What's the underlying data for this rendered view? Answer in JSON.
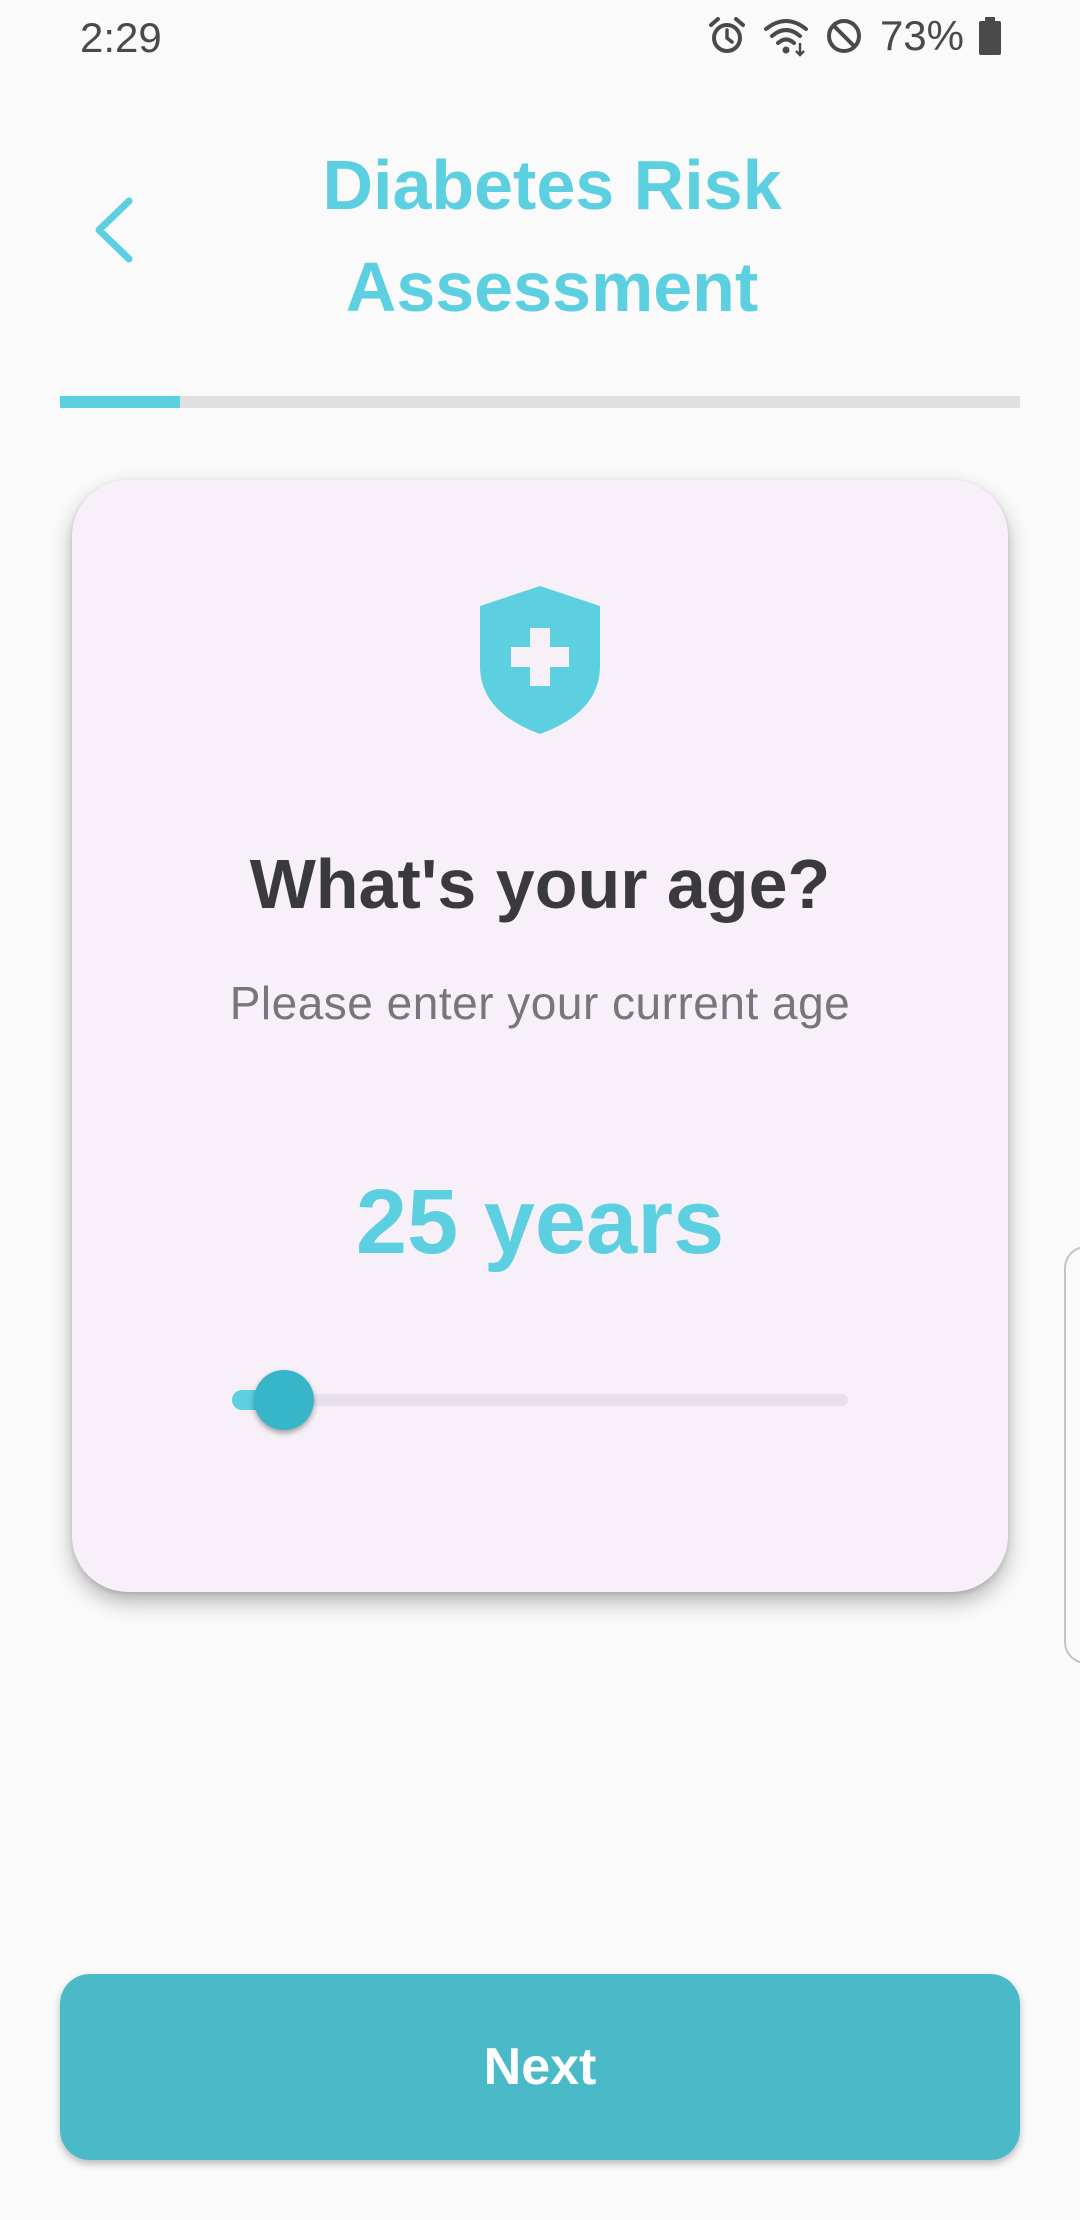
{
  "status_bar": {
    "time": "2:29",
    "battery": "73%",
    "icons": [
      "alarm-icon",
      "wifi-icon",
      "do-not-disturb-icon",
      "battery-icon"
    ]
  },
  "header": {
    "back_icon": "chevron-left-icon",
    "title_line1": "Diabetes Risk",
    "title_line2": "Assessment"
  },
  "progress": {
    "fraction": 0.125
  },
  "card": {
    "icon": "shield-plus-icon",
    "question": "What's your age?",
    "subtitle": "Please enter your current age",
    "age_number": "25",
    "age_unit": "years",
    "slider_fraction": 0.085
  },
  "next_button": {
    "label": "Next"
  },
  "colors": {
    "accent": "#5ccfe0",
    "button": "#4abac9",
    "card_background": "#f7f0f8",
    "question_text": "#3a3a3c",
    "subtitle_text": "#77767b"
  }
}
